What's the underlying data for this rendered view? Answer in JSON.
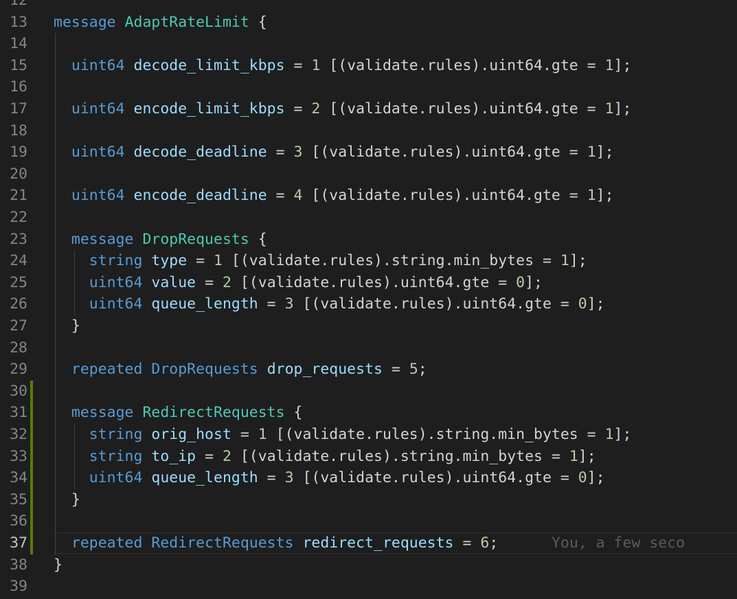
{
  "editor": {
    "lines": [
      {
        "num": "12",
        "tokens": []
      },
      {
        "num": "13",
        "tokens": [
          {
            "t": "message ",
            "c": "kw"
          },
          {
            "t": "AdaptRateLimit",
            "c": "ty"
          },
          {
            "t": " {",
            "c": "pl"
          }
        ]
      },
      {
        "num": "14",
        "tokens": []
      },
      {
        "num": "15",
        "tokens": [
          {
            "t": "  ",
            "c": "pl"
          },
          {
            "t": "uint64 ",
            "c": "kw"
          },
          {
            "t": "decode_limit_kbps",
            "c": "id"
          },
          {
            "t": " = ",
            "c": "pl"
          },
          {
            "t": "1",
            "c": "num"
          },
          {
            "t": " [(validate.rules).uint64.gte = ",
            "c": "pl"
          },
          {
            "t": "1",
            "c": "num"
          },
          {
            "t": "];",
            "c": "pl"
          }
        ]
      },
      {
        "num": "16",
        "tokens": []
      },
      {
        "num": "17",
        "tokens": [
          {
            "t": "  ",
            "c": "pl"
          },
          {
            "t": "uint64 ",
            "c": "kw"
          },
          {
            "t": "encode_limit_kbps",
            "c": "id"
          },
          {
            "t": " = ",
            "c": "pl"
          },
          {
            "t": "2",
            "c": "num"
          },
          {
            "t": " [(validate.rules).uint64.gte = ",
            "c": "pl"
          },
          {
            "t": "1",
            "c": "num"
          },
          {
            "t": "];",
            "c": "pl"
          }
        ]
      },
      {
        "num": "18",
        "tokens": []
      },
      {
        "num": "19",
        "tokens": [
          {
            "t": "  ",
            "c": "pl"
          },
          {
            "t": "uint64 ",
            "c": "kw"
          },
          {
            "t": "decode_deadline",
            "c": "id"
          },
          {
            "t": " = ",
            "c": "pl"
          },
          {
            "t": "3",
            "c": "num"
          },
          {
            "t": " [(validate.rules).uint64.gte = ",
            "c": "pl"
          },
          {
            "t": "1",
            "c": "num"
          },
          {
            "t": "];",
            "c": "pl"
          }
        ]
      },
      {
        "num": "20",
        "tokens": []
      },
      {
        "num": "21",
        "tokens": [
          {
            "t": "  ",
            "c": "pl"
          },
          {
            "t": "uint64 ",
            "c": "kw"
          },
          {
            "t": "encode_deadline",
            "c": "id"
          },
          {
            "t": " = ",
            "c": "pl"
          },
          {
            "t": "4",
            "c": "num"
          },
          {
            "t": " [(validate.rules).uint64.gte = ",
            "c": "pl"
          },
          {
            "t": "1",
            "c": "num"
          },
          {
            "t": "];",
            "c": "pl"
          }
        ]
      },
      {
        "num": "22",
        "tokens": []
      },
      {
        "num": "23",
        "tokens": [
          {
            "t": "  ",
            "c": "pl"
          },
          {
            "t": "message ",
            "c": "kw"
          },
          {
            "t": "DropRequests",
            "c": "ty"
          },
          {
            "t": " {",
            "c": "pl"
          }
        ]
      },
      {
        "num": "24",
        "tokens": [
          {
            "t": "    ",
            "c": "pl"
          },
          {
            "t": "string ",
            "c": "kw"
          },
          {
            "t": "type",
            "c": "id"
          },
          {
            "t": " = ",
            "c": "pl"
          },
          {
            "t": "1",
            "c": "num"
          },
          {
            "t": " [(validate.rules).string.min_bytes = ",
            "c": "pl"
          },
          {
            "t": "1",
            "c": "num"
          },
          {
            "t": "];",
            "c": "pl"
          }
        ]
      },
      {
        "num": "25",
        "tokens": [
          {
            "t": "    ",
            "c": "pl"
          },
          {
            "t": "uint64 ",
            "c": "kw"
          },
          {
            "t": "value",
            "c": "id"
          },
          {
            "t": " = ",
            "c": "pl"
          },
          {
            "t": "2",
            "c": "num"
          },
          {
            "t": " [(validate.rules).uint64.gte = ",
            "c": "pl"
          },
          {
            "t": "0",
            "c": "num"
          },
          {
            "t": "];",
            "c": "pl"
          }
        ]
      },
      {
        "num": "26",
        "tokens": [
          {
            "t": "    ",
            "c": "pl"
          },
          {
            "t": "uint64 ",
            "c": "kw"
          },
          {
            "t": "queue_length",
            "c": "id"
          },
          {
            "t": " = ",
            "c": "pl"
          },
          {
            "t": "3",
            "c": "num"
          },
          {
            "t": " [(validate.rules).uint64.gte = ",
            "c": "pl"
          },
          {
            "t": "0",
            "c": "num"
          },
          {
            "t": "];",
            "c": "pl"
          }
        ]
      },
      {
        "num": "27",
        "tokens": [
          {
            "t": "  }",
            "c": "pl"
          }
        ]
      },
      {
        "num": "28",
        "tokens": []
      },
      {
        "num": "29",
        "tokens": [
          {
            "t": "  ",
            "c": "pl"
          },
          {
            "t": "repeated ",
            "c": "kw"
          },
          {
            "t": "DropRequests",
            "c": "kw"
          },
          {
            "t": " ",
            "c": "pl"
          },
          {
            "t": "drop_requests",
            "c": "id"
          },
          {
            "t": " = ",
            "c": "pl"
          },
          {
            "t": "5",
            "c": "num"
          },
          {
            "t": ";",
            "c": "pl"
          }
        ]
      },
      {
        "num": "30",
        "tokens": []
      },
      {
        "num": "31",
        "tokens": [
          {
            "t": "  ",
            "c": "pl"
          },
          {
            "t": "message ",
            "c": "kw"
          },
          {
            "t": "RedirectRequests",
            "c": "ty"
          },
          {
            "t": " {",
            "c": "pl"
          }
        ]
      },
      {
        "num": "32",
        "tokens": [
          {
            "t": "    ",
            "c": "pl"
          },
          {
            "t": "string ",
            "c": "kw"
          },
          {
            "t": "orig_host",
            "c": "id"
          },
          {
            "t": " = ",
            "c": "pl"
          },
          {
            "t": "1",
            "c": "num"
          },
          {
            "t": " [(validate.rules).string.min_bytes = ",
            "c": "pl"
          },
          {
            "t": "1",
            "c": "num"
          },
          {
            "t": "];",
            "c": "pl"
          }
        ]
      },
      {
        "num": "33",
        "tokens": [
          {
            "t": "    ",
            "c": "pl"
          },
          {
            "t": "string ",
            "c": "kw"
          },
          {
            "t": "to_ip",
            "c": "id"
          },
          {
            "t": " = ",
            "c": "pl"
          },
          {
            "t": "2",
            "c": "num"
          },
          {
            "t": " [(validate.rules).string.min_bytes = ",
            "c": "pl"
          },
          {
            "t": "1",
            "c": "num"
          },
          {
            "t": "];",
            "c": "pl"
          }
        ]
      },
      {
        "num": "34",
        "tokens": [
          {
            "t": "    ",
            "c": "pl"
          },
          {
            "t": "uint64 ",
            "c": "kw"
          },
          {
            "t": "queue_length",
            "c": "id"
          },
          {
            "t": " = ",
            "c": "pl"
          },
          {
            "t": "3",
            "c": "num"
          },
          {
            "t": " [(validate.rules).uint64.gte = ",
            "c": "pl"
          },
          {
            "t": "0",
            "c": "num"
          },
          {
            "t": "];",
            "c": "pl"
          }
        ]
      },
      {
        "num": "35",
        "tokens": [
          {
            "t": "  }",
            "c": "pl"
          }
        ]
      },
      {
        "num": "36",
        "tokens": []
      },
      {
        "num": "37",
        "tokens": [
          {
            "t": "  ",
            "c": "pl"
          },
          {
            "t": "repeated ",
            "c": "kw"
          },
          {
            "t": "RedirectRequests",
            "c": "kw"
          },
          {
            "t": " ",
            "c": "pl"
          },
          {
            "t": "redirect_requests",
            "c": "id"
          },
          {
            "t": " = ",
            "c": "pl"
          },
          {
            "t": "6",
            "c": "num"
          },
          {
            "t": ";",
            "c": "pl"
          },
          {
            "t": "      You, a few seco",
            "c": "blame"
          }
        ]
      },
      {
        "num": "38",
        "tokens": [
          {
            "t": "}",
            "c": "pl"
          }
        ]
      },
      {
        "num": "39",
        "tokens": []
      }
    ],
    "active_line": "37",
    "modified_lines": [
      "30",
      "31",
      "32",
      "33",
      "34",
      "35",
      "36",
      "37"
    ],
    "colors": {
      "background": "#1e1e1e",
      "keyword": "#569cd6",
      "type": "#4ec9b0",
      "identifier": "#9cdcfe",
      "number": "#b5cea8",
      "modified_gutter": "#587c0c",
      "blame": "#5a5a5a"
    }
  }
}
